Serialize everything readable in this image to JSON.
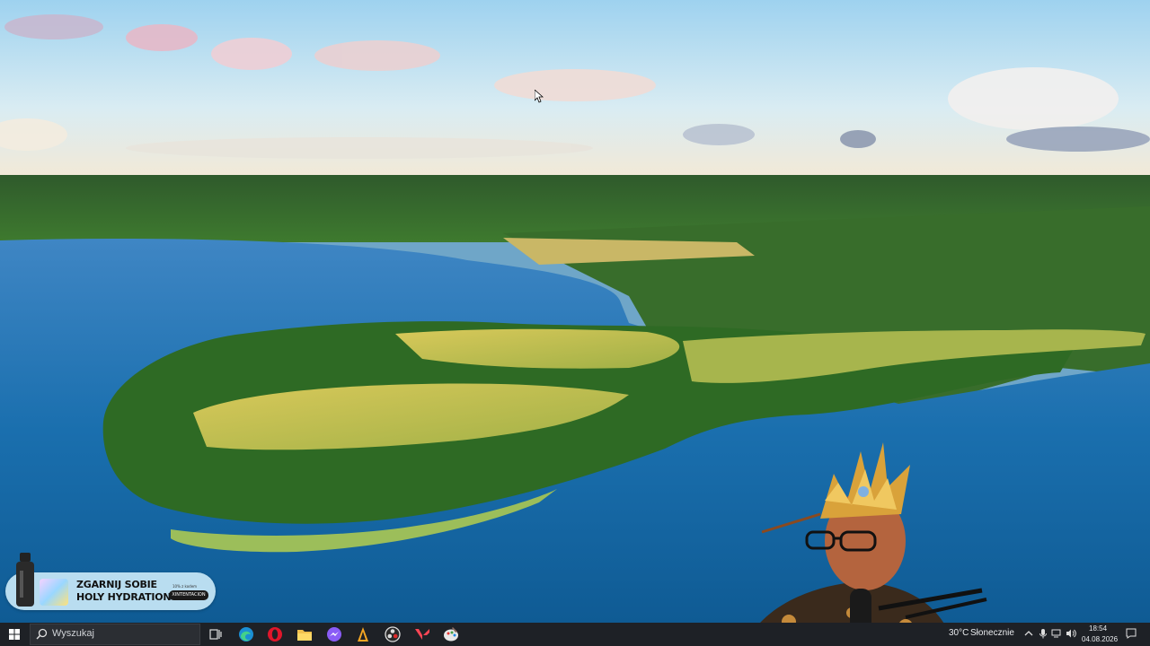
{
  "promo": {
    "line1": "ZGARNIJ SOBIE",
    "line2": "HOLY HYDRATION",
    "fine_print": "10% z kodem",
    "badge": "XINTENTACION"
  },
  "taskbar": {
    "search_placeholder": "Wyszukaj",
    "pinned": [
      {
        "name": "task-view-icon"
      },
      {
        "name": "edge-browser-icon"
      },
      {
        "name": "opera-browser-icon"
      },
      {
        "name": "file-explorer-icon"
      },
      {
        "name": "messenger-app-icon"
      },
      {
        "name": "game-launcher-icon"
      },
      {
        "name": "obs-studio-icon"
      },
      {
        "name": "valorant-icon"
      },
      {
        "name": "paint-app-icon"
      }
    ]
  },
  "tray": {
    "weather_temp": "30°C",
    "weather_text": "Słonecznie",
    "time": "18:54",
    "date": "04.08.2026"
  },
  "colors": {
    "taskbar_bg": "#1e2126",
    "accent_blue": "#1a8fd6"
  }
}
